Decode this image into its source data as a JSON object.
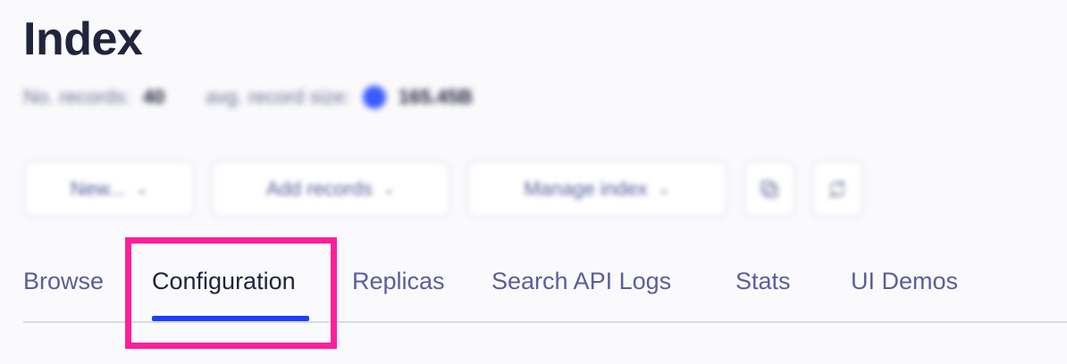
{
  "header": {
    "title": "Index",
    "records_label": "No. records:",
    "records_value": "40",
    "avg_size_label": "avg. record size:",
    "avg_size_value": "165.45B"
  },
  "toolbar": {
    "new_label": "New...",
    "add_records_label": "Add records",
    "manage_index_label": "Manage index",
    "copy_icon": "copy-icon",
    "refresh_icon": "refresh-icon"
  },
  "tabs": [
    {
      "label": "Browse",
      "active": false
    },
    {
      "label": "Configuration",
      "active": true
    },
    {
      "label": "Replicas",
      "active": false
    },
    {
      "label": "Search API Logs",
      "active": false
    },
    {
      "label": "Stats",
      "active": false
    },
    {
      "label": "UI Demos",
      "active": false
    }
  ],
  "colors": {
    "accent": "#1f3eff",
    "highlight": "#ff1f9a",
    "title": "#21243d",
    "tab_text": "#5a5e9a"
  }
}
